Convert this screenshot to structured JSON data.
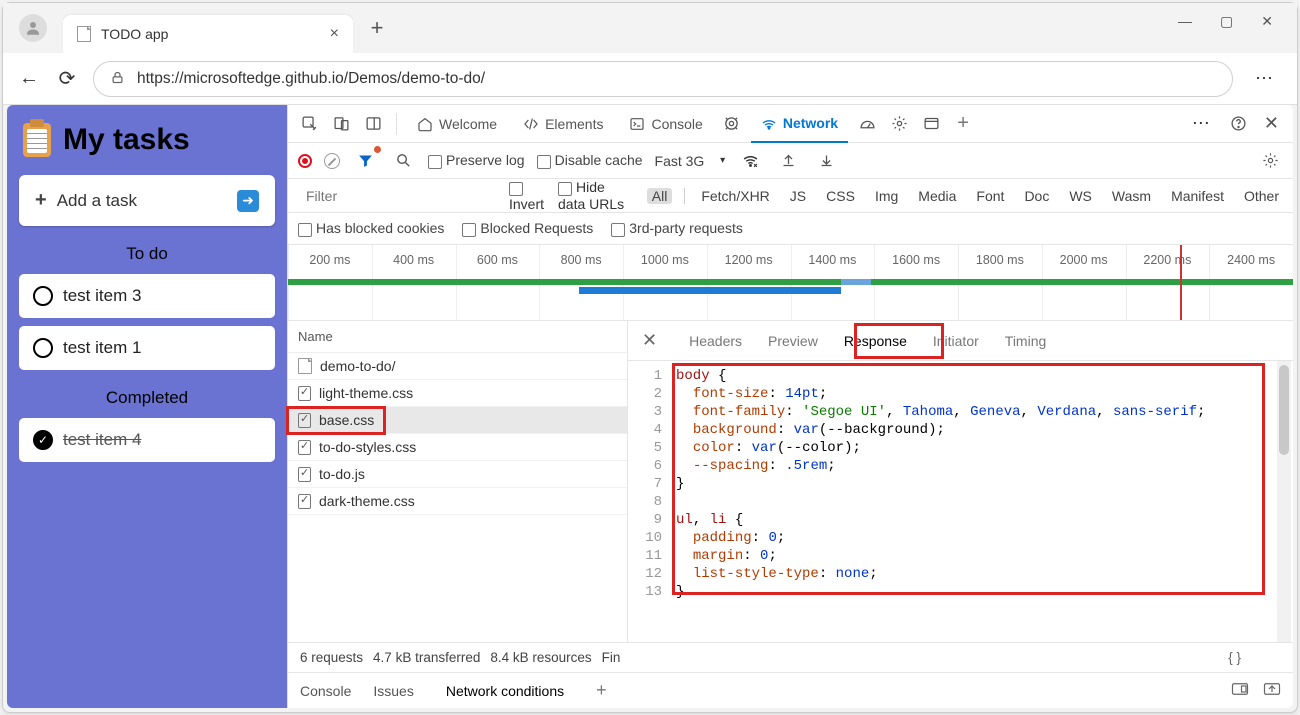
{
  "browser": {
    "tab_title": "TODO app",
    "url": "https://microsoftedge.github.io/Demos/demo-to-do/"
  },
  "page": {
    "title": "My tasks",
    "add_task": "Add a task",
    "sections": {
      "todo": "To do",
      "completed": "Completed"
    },
    "todo_items": [
      "test item 3",
      "test item 1"
    ],
    "done_items": [
      "test item 4"
    ]
  },
  "devtools": {
    "tabs": {
      "welcome": "Welcome",
      "elements": "Elements",
      "console": "Console",
      "network": "Network"
    },
    "toolbar": {
      "preserve": "Preserve log",
      "disable_cache": "Disable cache",
      "throttling": "Fast 3G"
    },
    "filter": {
      "placeholder": "Filter",
      "invert": "Invert",
      "hide_data": "Hide data URLs",
      "types": [
        "All",
        "Fetch/XHR",
        "JS",
        "CSS",
        "Img",
        "Media",
        "Font",
        "Doc",
        "WS",
        "Wasm",
        "Manifest",
        "Other"
      ]
    },
    "filter2": {
      "blocked_cookies": "Has blocked cookies",
      "blocked_req": "Blocked Requests",
      "third_party": "3rd-party requests"
    },
    "timeline_ticks": [
      "200 ms",
      "400 ms",
      "600 ms",
      "800 ms",
      "1000 ms",
      "1200 ms",
      "1400 ms",
      "1600 ms",
      "1800 ms",
      "2000 ms",
      "2200 ms",
      "2400 ms"
    ],
    "name_header": "Name",
    "requests": [
      {
        "name": "demo-to-do/",
        "type": "doc"
      },
      {
        "name": "light-theme.css",
        "type": "css"
      },
      {
        "name": "base.css",
        "type": "css",
        "selected": true
      },
      {
        "name": "to-do-styles.css",
        "type": "css"
      },
      {
        "name": "to-do.js",
        "type": "css"
      },
      {
        "name": "dark-theme.css",
        "type": "css"
      }
    ],
    "detail_tabs": [
      "Headers",
      "Preview",
      "Response",
      "Initiator",
      "Timing"
    ],
    "active_detail_tab": "Response",
    "code_lines": [
      [
        [
          "c-sel",
          "body"
        ],
        [
          "c-punc",
          " {"
        ]
      ],
      [
        [
          "",
          "  "
        ],
        [
          "c-prop",
          "font-size"
        ],
        [
          "c-punc",
          ": "
        ],
        [
          "c-num",
          "14pt"
        ],
        [
          "c-punc",
          ";"
        ]
      ],
      [
        [
          "",
          "  "
        ],
        [
          "c-prop",
          "font-family"
        ],
        [
          "c-punc",
          ": "
        ],
        [
          "c-str",
          "'Segoe UI'"
        ],
        [
          "c-punc",
          ", "
        ],
        [
          "c-kw",
          "Tahoma"
        ],
        [
          "c-punc",
          ", "
        ],
        [
          "c-kw",
          "Geneva"
        ],
        [
          "c-punc",
          ", "
        ],
        [
          "c-kw",
          "Verdana"
        ],
        [
          "c-punc",
          ", "
        ],
        [
          "c-kw",
          "sans-serif"
        ],
        [
          "c-punc",
          ";"
        ]
      ],
      [
        [
          "",
          "  "
        ],
        [
          "c-prop",
          "background"
        ],
        [
          "c-punc",
          ": "
        ],
        [
          "c-var",
          "var"
        ],
        [
          "c-punc",
          "(--background);"
        ]
      ],
      [
        [
          "",
          "  "
        ],
        [
          "c-prop",
          "color"
        ],
        [
          "c-punc",
          ": "
        ],
        [
          "c-var",
          "var"
        ],
        [
          "c-punc",
          "(--color);"
        ]
      ],
      [
        [
          "",
          "  "
        ],
        [
          "c-prop",
          "--spacing"
        ],
        [
          "c-punc",
          ": "
        ],
        [
          "c-num",
          ".5rem"
        ],
        [
          "c-punc",
          ";"
        ]
      ],
      [
        [
          "c-punc",
          "}"
        ]
      ],
      [
        [
          "",
          ""
        ]
      ],
      [
        [
          "c-sel",
          "ul"
        ],
        [
          "c-punc",
          ", "
        ],
        [
          "c-sel",
          "li"
        ],
        [
          "c-punc",
          " {"
        ]
      ],
      [
        [
          "",
          "  "
        ],
        [
          "c-prop",
          "padding"
        ],
        [
          "c-punc",
          ": "
        ],
        [
          "c-num",
          "0"
        ],
        [
          "c-punc",
          ";"
        ]
      ],
      [
        [
          "",
          "  "
        ],
        [
          "c-prop",
          "margin"
        ],
        [
          "c-punc",
          ": "
        ],
        [
          "c-num",
          "0"
        ],
        [
          "c-punc",
          ";"
        ]
      ],
      [
        [
          "",
          "  "
        ],
        [
          "c-prop",
          "list-style-type"
        ],
        [
          "c-punc",
          ": "
        ],
        [
          "c-kw",
          "none"
        ],
        [
          "c-punc",
          ";"
        ]
      ],
      [
        [
          "c-punc",
          "}"
        ]
      ]
    ],
    "status": {
      "requests": "6 requests",
      "transferred": "4.7 kB transferred",
      "resources": "8.4 kB resources",
      "finish": "Fin"
    },
    "drawer": {
      "console": "Console",
      "issues": "Issues",
      "network_conditions": "Network conditions"
    }
  }
}
